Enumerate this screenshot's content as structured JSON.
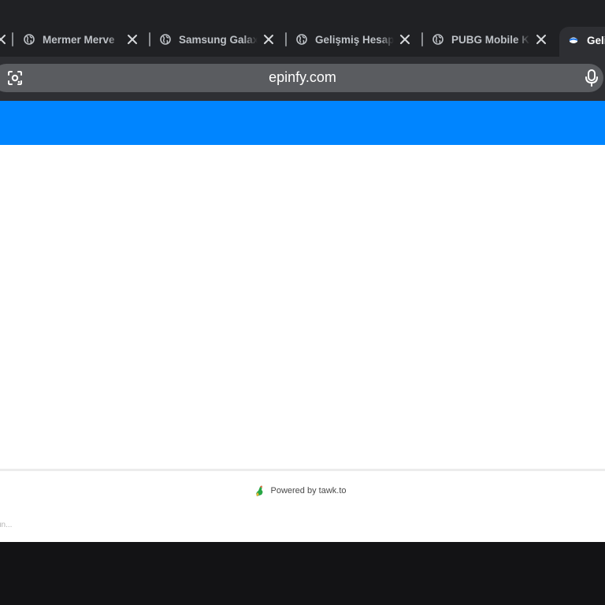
{
  "browser": {
    "tabs": [
      {
        "title": "Mermer Merve",
        "icon": "globe-icon"
      },
      {
        "title": "Samsung Galaxy",
        "icon": "globe-icon"
      },
      {
        "title": "Gelişmiş Hesap",
        "icon": "globe-icon"
      },
      {
        "title": "PUBG Mobile Ko",
        "icon": "globe-icon"
      }
    ],
    "active_tab": {
      "title": "Geli",
      "icon": "epinfy-favicon"
    },
    "address_bar": {
      "url": "epinfy.com"
    }
  },
  "page": {
    "header_color": "#0085ff",
    "chat_widget": {
      "powered_by": "Powered by tawk.to",
      "composer_placeholder": "un..."
    }
  }
}
